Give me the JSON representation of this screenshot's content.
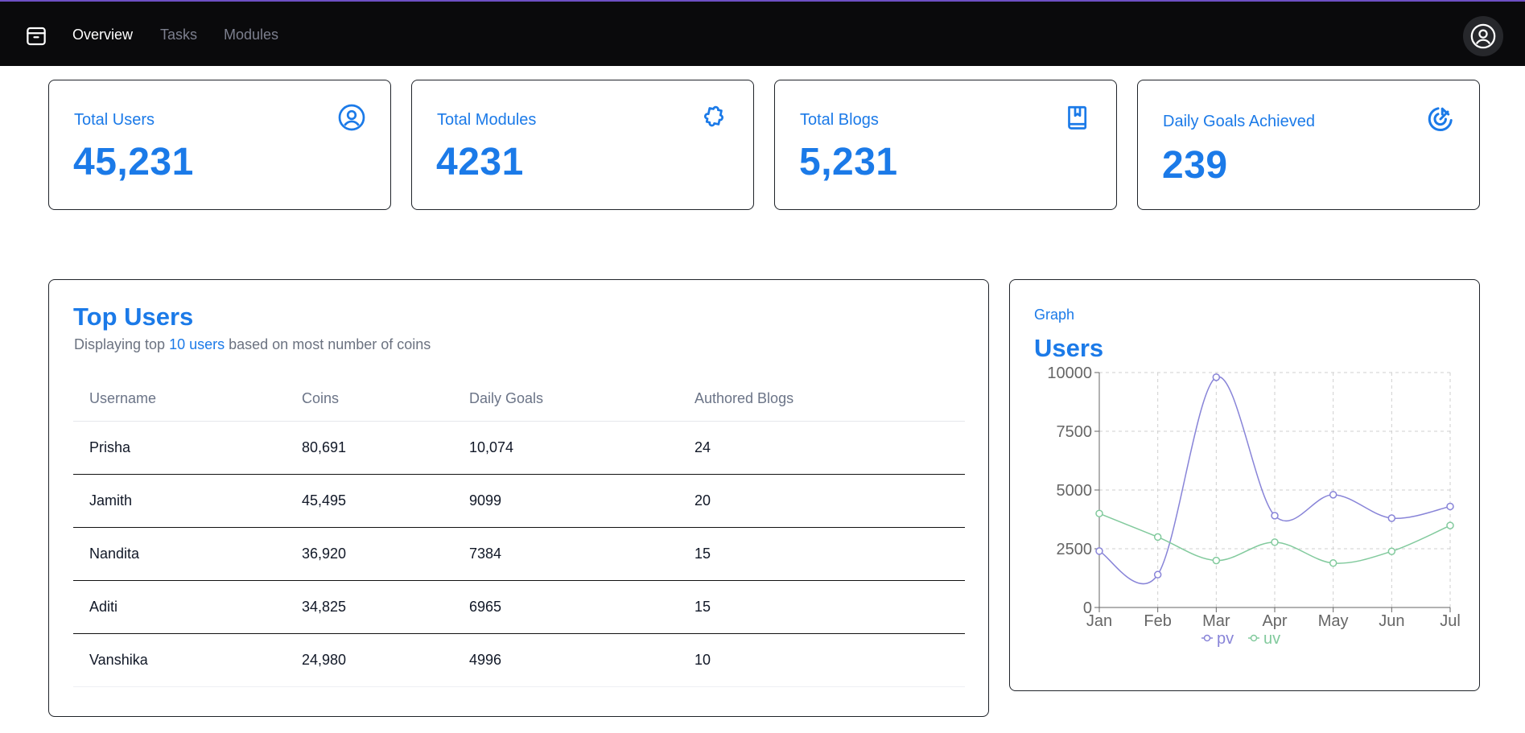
{
  "nav": {
    "logo_icon": "package-box-icon",
    "items": [
      {
        "label": "Overview",
        "active": true
      },
      {
        "label": "Tasks",
        "active": false
      },
      {
        "label": "Modules",
        "active": false
      }
    ],
    "avatar_icon": "user-circle-icon",
    "accent_color": "#6d4fc4"
  },
  "stats": [
    {
      "label": "Total Users",
      "value": "45,231",
      "icon": "user-circle-icon"
    },
    {
      "label": "Total Modules",
      "value": "4231",
      "icon": "puzzle-icon"
    },
    {
      "label": "Total Blogs",
      "value": "5,231",
      "icon": "book-bookmark-icon"
    },
    {
      "label": "Daily Goals Achieved",
      "value": "239",
      "icon": "target-arrow-icon"
    }
  ],
  "top_users": {
    "title": "Top Users",
    "subtitle_prefix": "Displaying top ",
    "subtitle_highlight": "10 users",
    "subtitle_suffix": " based on most number of coins",
    "columns": [
      "Username",
      "Coins",
      "Daily Goals",
      "Authored Blogs"
    ],
    "rows": [
      [
        "Prisha",
        "80,691",
        "10,074",
        "24"
      ],
      [
        "Jamith",
        "45,495",
        "9099",
        "20"
      ],
      [
        "Nandita",
        "36,920",
        "7384",
        "15"
      ],
      [
        "Aditi",
        "34,825",
        "6965",
        "15"
      ],
      [
        "Vanshika",
        "24,980",
        "4996",
        "10"
      ]
    ]
  },
  "graph": {
    "kicker": "Graph",
    "title": "Users"
  },
  "chart_data": {
    "type": "line",
    "categories": [
      "Jan",
      "Feb",
      "Mar",
      "Apr",
      "May",
      "Jun",
      "Jul"
    ],
    "series": [
      {
        "name": "pv",
        "color": "#8884d8",
        "values": [
          2400,
          1398,
          9800,
          3908,
          4800,
          3800,
          4300
        ]
      },
      {
        "name": "uv",
        "color": "#82ca9d",
        "values": [
          4000,
          3000,
          2000,
          2780,
          1890,
          2390,
          3490
        ]
      }
    ],
    "yticks": [
      0,
      2500,
      7500,
      5000,
      10000
    ],
    "ylim": [
      0,
      10000
    ],
    "grid": true,
    "legend": "bottom-center"
  },
  "brand_color": "#1b7ae8"
}
